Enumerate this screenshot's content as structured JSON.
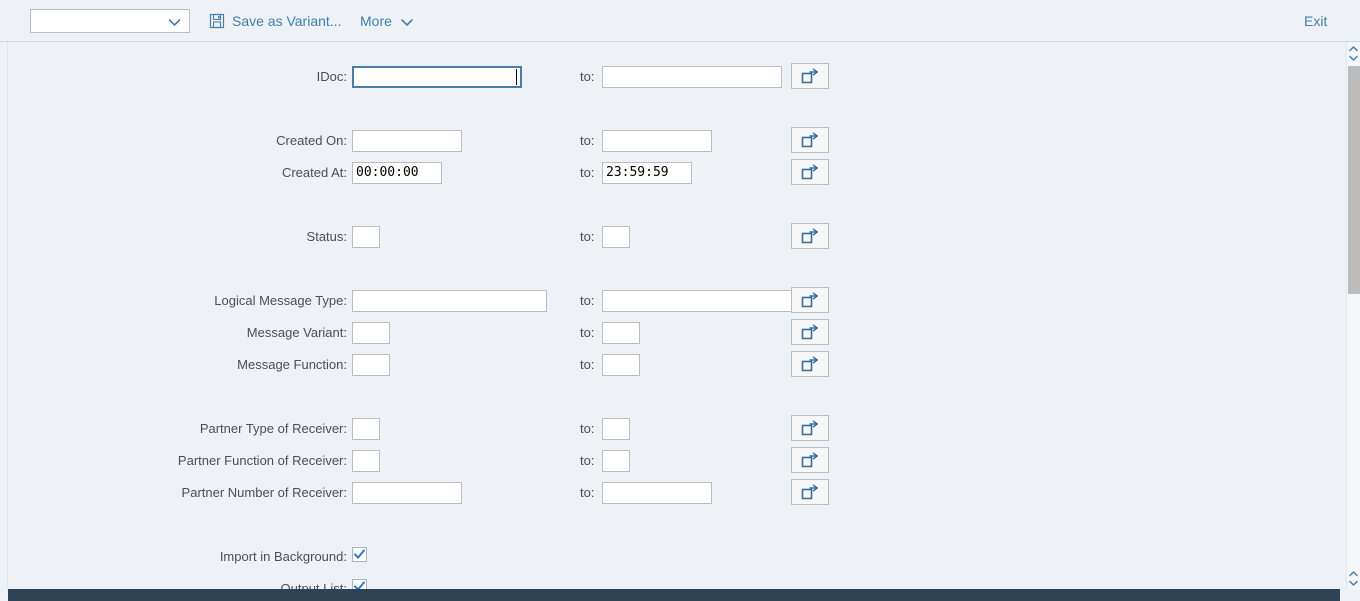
{
  "toolbar": {
    "variant_value": "",
    "variant_placeholder": "",
    "save_label": "Save as Variant...",
    "save_icon": "floppy-disk-icon",
    "more_label": "More",
    "more_icon": "chevron-down-icon",
    "exit_label": "Exit"
  },
  "selection_screen": {
    "to_label": "to:",
    "multi_select_icon": "multiple-selection-icon",
    "rows": [
      {
        "label": "IDoc:",
        "from_value": "",
        "to_value": "",
        "focused": true,
        "has_multiselect": true,
        "type": "range"
      },
      {
        "label": "Created On:",
        "from_value": "",
        "to_value": "",
        "focused": false,
        "has_multiselect": true,
        "type": "range"
      },
      {
        "label": "Created At:",
        "from_value": "00:00:00",
        "to_value": "23:59:59",
        "focused": false,
        "has_multiselect": true,
        "type": "range"
      },
      {
        "label": "Status:",
        "from_value": "",
        "to_value": "",
        "focused": false,
        "has_multiselect": true,
        "type": "range"
      },
      {
        "label": "Logical Message Type:",
        "from_value": "",
        "to_value": "",
        "focused": false,
        "has_multiselect": true,
        "type": "range"
      },
      {
        "label": "Message Variant:",
        "from_value": "",
        "to_value": "",
        "focused": false,
        "has_multiselect": true,
        "type": "range"
      },
      {
        "label": "Message Function:",
        "from_value": "",
        "to_value": "",
        "focused": false,
        "has_multiselect": true,
        "type": "range"
      },
      {
        "label": "Partner Type of Receiver:",
        "from_value": "",
        "to_value": "",
        "focused": false,
        "has_multiselect": true,
        "type": "range"
      },
      {
        "label": "Partner Function of Receiver:",
        "from_value": "",
        "to_value": "",
        "focused": false,
        "has_multiselect": true,
        "type": "range"
      },
      {
        "label": "Partner Number of Receiver:",
        "from_value": "",
        "to_value": "",
        "focused": false,
        "has_multiselect": true,
        "type": "range"
      },
      {
        "label": "Import in Background:",
        "checked": true,
        "type": "checkbox"
      },
      {
        "label": "Output List:",
        "checked": true,
        "type": "checkbox"
      }
    ]
  },
  "scrollbars": {
    "vertical_up_icon": "chevron-up-icon",
    "vertical_down_icon": "chevron-down-icon",
    "horizontal_position": "left"
  },
  "colors": {
    "background": "#eef2f6",
    "accent_link": "#3f7faa",
    "field_border": "#b6bdc4",
    "focus_border": "#2b5f86",
    "hscroll": "#2f4356",
    "vscroll_thumb": "#bcbcbc"
  }
}
